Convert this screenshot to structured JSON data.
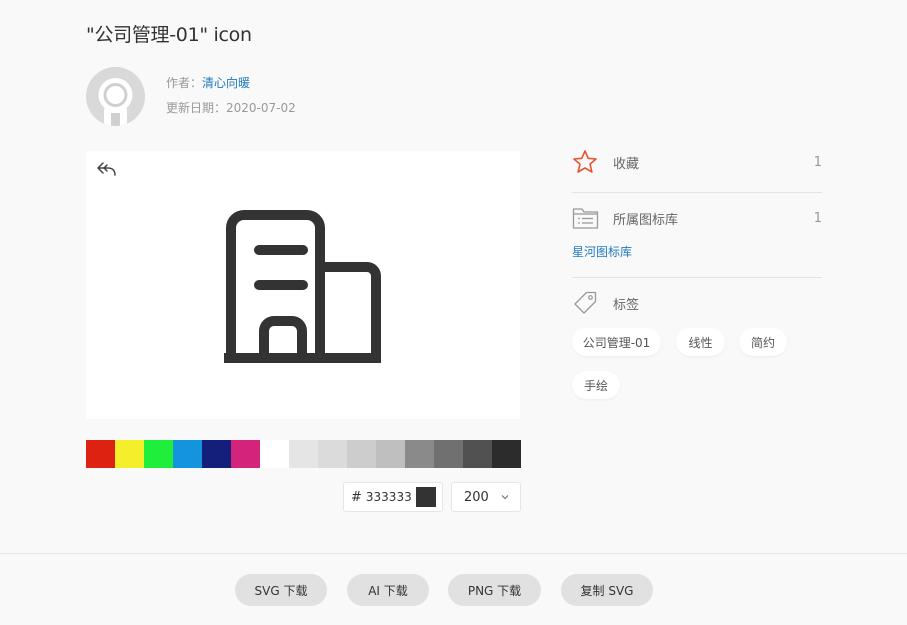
{
  "header": {
    "title": "\"公司管理-01\" icon",
    "author_label": "作者：",
    "author_name": "清心向暖",
    "date_label": "更新日期：",
    "date_value": "2020-07-02"
  },
  "palette": {
    "colors": [
      "#dd2211",
      "#f5ee2b",
      "#1fee3a",
      "#1394dd",
      "#141f7c",
      "#d4237a",
      "#ffffff",
      "#e5e5e5",
      "#dbdbdb",
      "#cdcdcd",
      "#bfbfbf",
      "#8a8a8a",
      "#707070",
      "#515151",
      "#2c2c2c"
    ]
  },
  "color_input": {
    "hash": "#",
    "value": "333333",
    "swatch": "#333333"
  },
  "size_select": {
    "value": "200"
  },
  "sidebar": {
    "favorite_label": "收藏",
    "favorite_count": "1",
    "library_label": "所属图标库",
    "library_count": "1",
    "library_name": "星河图标库",
    "tags_label": "标签",
    "tags": [
      "公司管理-01",
      "线性",
      "简约",
      "手绘"
    ],
    "accent_color": "#e8532f"
  },
  "footer": {
    "svg_download": "SVG 下载",
    "ai_download": "AI 下载",
    "png_download": "PNG 下载",
    "copy_svg": "复制 SVG"
  }
}
